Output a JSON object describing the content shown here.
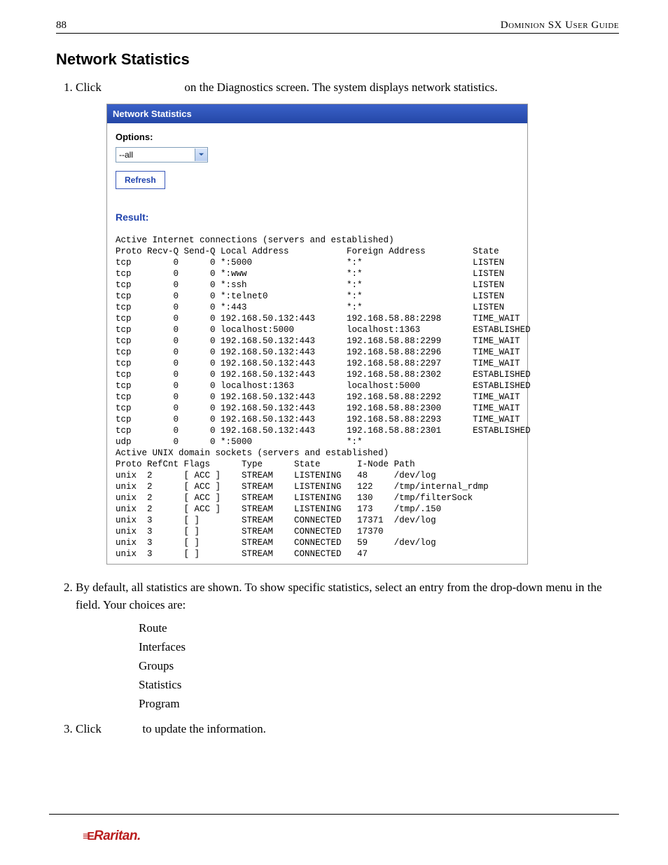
{
  "header": {
    "page_num": "88",
    "guide_title": "Dominion SX User Guide"
  },
  "section_title": "Network Statistics",
  "step1": {
    "prefix": "Click",
    "suffix": "on the Diagnostics screen. The system displays network statistics."
  },
  "panel": {
    "title": "Network Statistics",
    "options_label": "Options:",
    "dropdown_value": "--all",
    "refresh_label": "Refresh",
    "result_label": "Result:"
  },
  "netstat": {
    "inet_header": "Active Internet connections (servers and established)",
    "inet_cols": {
      "proto": "Proto",
      "recvq": "Recv-Q",
      "sendq": "Send-Q",
      "local": "Local Address",
      "foreign": "Foreign Address",
      "state": "State"
    },
    "inet_rows": [
      {
        "proto": "tcp",
        "recvq": "0",
        "sendq": "0",
        "local": "*:5000",
        "foreign": "*:*",
        "state": "LISTEN"
      },
      {
        "proto": "tcp",
        "recvq": "0",
        "sendq": "0",
        "local": "*:www",
        "foreign": "*:*",
        "state": "LISTEN"
      },
      {
        "proto": "tcp",
        "recvq": "0",
        "sendq": "0",
        "local": "*:ssh",
        "foreign": "*:*",
        "state": "LISTEN"
      },
      {
        "proto": "tcp",
        "recvq": "0",
        "sendq": "0",
        "local": "*:telnet0",
        "foreign": "*:*",
        "state": "LISTEN"
      },
      {
        "proto": "tcp",
        "recvq": "0",
        "sendq": "0",
        "local": "*:443",
        "foreign": "*:*",
        "state": "LISTEN"
      },
      {
        "proto": "tcp",
        "recvq": "0",
        "sendq": "0",
        "local": "192.168.50.132:443",
        "foreign": "192.168.58.88:2298",
        "state": "TIME_WAIT"
      },
      {
        "proto": "tcp",
        "recvq": "0",
        "sendq": "0",
        "local": "localhost:5000",
        "foreign": "localhost:1363",
        "state": "ESTABLISHED"
      },
      {
        "proto": "tcp",
        "recvq": "0",
        "sendq": "0",
        "local": "192.168.50.132:443",
        "foreign": "192.168.58.88:2299",
        "state": "TIME_WAIT"
      },
      {
        "proto": "tcp",
        "recvq": "0",
        "sendq": "0",
        "local": "192.168.50.132:443",
        "foreign": "192.168.58.88:2296",
        "state": "TIME_WAIT"
      },
      {
        "proto": "tcp",
        "recvq": "0",
        "sendq": "0",
        "local": "192.168.50.132:443",
        "foreign": "192.168.58.88:2297",
        "state": "TIME_WAIT"
      },
      {
        "proto": "tcp",
        "recvq": "0",
        "sendq": "0",
        "local": "192.168.50.132:443",
        "foreign": "192.168.58.88:2302",
        "state": "ESTABLISHED"
      },
      {
        "proto": "tcp",
        "recvq": "0",
        "sendq": "0",
        "local": "localhost:1363",
        "foreign": "localhost:5000",
        "state": "ESTABLISHED"
      },
      {
        "proto": "tcp",
        "recvq": "0",
        "sendq": "0",
        "local": "192.168.50.132:443",
        "foreign": "192.168.58.88:2292",
        "state": "TIME_WAIT"
      },
      {
        "proto": "tcp",
        "recvq": "0",
        "sendq": "0",
        "local": "192.168.50.132:443",
        "foreign": "192.168.58.88:2300",
        "state": "TIME_WAIT"
      },
      {
        "proto": "tcp",
        "recvq": "0",
        "sendq": "0",
        "local": "192.168.50.132:443",
        "foreign": "192.168.58.88:2293",
        "state": "TIME_WAIT"
      },
      {
        "proto": "tcp",
        "recvq": "0",
        "sendq": "0",
        "local": "192.168.50.132:443",
        "foreign": "192.168.58.88:2301",
        "state": "ESTABLISHED"
      },
      {
        "proto": "udp",
        "recvq": "0",
        "sendq": "0",
        "local": "*:5000",
        "foreign": "*:*",
        "state": ""
      }
    ],
    "unix_header": "Active UNIX domain sockets (servers and established)",
    "unix_cols": {
      "proto": "Proto",
      "refcnt": "RefCnt",
      "flags": "Flags",
      "type": "Type",
      "state": "State",
      "inode": "I-Node",
      "path": "Path"
    },
    "unix_rows": [
      {
        "proto": "unix",
        "refcnt": "2",
        "flags": "[ ACC ]",
        "type": "STREAM",
        "state": "LISTENING",
        "inode": "48",
        "path": "/dev/log"
      },
      {
        "proto": "unix",
        "refcnt": "2",
        "flags": "[ ACC ]",
        "type": "STREAM",
        "state": "LISTENING",
        "inode": "122",
        "path": "/tmp/internal_rdmp"
      },
      {
        "proto": "unix",
        "refcnt": "2",
        "flags": "[ ACC ]",
        "type": "STREAM",
        "state": "LISTENING",
        "inode": "130",
        "path": "/tmp/filterSock"
      },
      {
        "proto": "unix",
        "refcnt": "2",
        "flags": "[ ACC ]",
        "type": "STREAM",
        "state": "LISTENING",
        "inode": "173",
        "path": "/tmp/.150"
      },
      {
        "proto": "unix",
        "refcnt": "3",
        "flags": "[ ]",
        "type": "STREAM",
        "state": "CONNECTED",
        "inode": "17371",
        "path": "/dev/log"
      },
      {
        "proto": "unix",
        "refcnt": "3",
        "flags": "[ ]",
        "type": "STREAM",
        "state": "CONNECTED",
        "inode": "17370",
        "path": ""
      },
      {
        "proto": "unix",
        "refcnt": "3",
        "flags": "[ ]",
        "type": "STREAM",
        "state": "CONNECTED",
        "inode": "59",
        "path": "/dev/log"
      },
      {
        "proto": "unix",
        "refcnt": "3",
        "flags": "[ ]",
        "type": "STREAM",
        "state": "CONNECTED",
        "inode": "47",
        "path": ""
      }
    ]
  },
  "step2": {
    "text_a": "By default, all statistics are shown. To show specific statistics, select an entry from the drop-down menu in the ",
    "text_b": " field. Your choices are:",
    "choices": [
      "Route",
      "Interfaces",
      "Groups",
      "Statistics",
      "Program"
    ]
  },
  "step3": {
    "prefix": "Click",
    "suffix": "to update the information."
  },
  "brand": "Raritan."
}
